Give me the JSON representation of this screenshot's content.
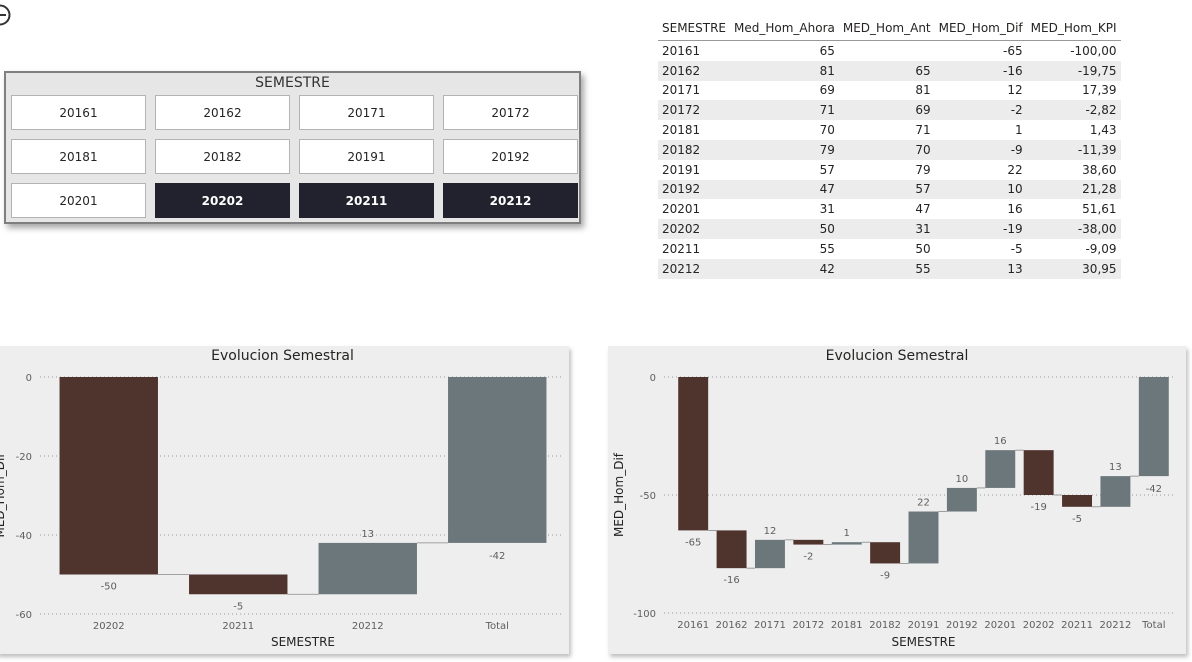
{
  "slicer": {
    "title": "SEMESTRE",
    "items": [
      {
        "label": "20161",
        "selected": false
      },
      {
        "label": "20162",
        "selected": false
      },
      {
        "label": "20171",
        "selected": false
      },
      {
        "label": "20172",
        "selected": false
      },
      {
        "label": "20181",
        "selected": false
      },
      {
        "label": "20182",
        "selected": false
      },
      {
        "label": "20191",
        "selected": false
      },
      {
        "label": "20192",
        "selected": false
      },
      {
        "label": "20201",
        "selected": false
      },
      {
        "label": "20202",
        "selected": true
      },
      {
        "label": "20211",
        "selected": true
      },
      {
        "label": "20212",
        "selected": true
      }
    ]
  },
  "table": {
    "columns": [
      "SEMESTRE",
      "Med_Hom_Ahora",
      "MED_Hom_Ant",
      "MED_Hom_Dif",
      "MED_Hom_KPI"
    ],
    "rows": [
      [
        "20161",
        "65",
        "",
        "-65",
        "-100,00"
      ],
      [
        "20162",
        "81",
        "65",
        "-16",
        "-19,75"
      ],
      [
        "20171",
        "69",
        "81",
        "12",
        "17,39"
      ],
      [
        "20172",
        "71",
        "69",
        "-2",
        "-2,82"
      ],
      [
        "20181",
        "70",
        "71",
        "1",
        "1,43"
      ],
      [
        "20182",
        "79",
        "70",
        "-9",
        "-11,39"
      ],
      [
        "20191",
        "57",
        "79",
        "22",
        "38,60"
      ],
      [
        "20192",
        "47",
        "57",
        "10",
        "21,28"
      ],
      [
        "20201",
        "31",
        "47",
        "16",
        "51,61"
      ],
      [
        "20202",
        "50",
        "31",
        "-19",
        "-38,00"
      ],
      [
        "20211",
        "55",
        "50",
        "-5",
        "-9,09"
      ],
      [
        "20212",
        "42",
        "55",
        "13",
        "30,95"
      ]
    ]
  },
  "colors": {
    "decrease": "#4f332d",
    "increase": "#6b777b",
    "total": "#6b777b",
    "selected": "#22222e"
  },
  "chart_data": [
    {
      "type": "bar",
      "subtype": "waterfall",
      "title": "Evolucion Semestral",
      "xlabel": "SEMESTRE",
      "ylabel": "MED_Hom_Dif",
      "categories": [
        "20202",
        "20211",
        "20212",
        "Total"
      ],
      "values": [
        -50,
        -5,
        13,
        -42
      ],
      "labels": [
        "-50",
        "-5",
        "13",
        "-42"
      ],
      "ylim": [
        -60,
        0
      ],
      "yticks": [
        "0",
        "-20",
        "-40",
        "-60"
      ],
      "grid": true
    },
    {
      "type": "bar",
      "subtype": "waterfall",
      "title": "Evolucion Semestral",
      "xlabel": "SEMESTRE",
      "ylabel": "MED_Hom_Dif",
      "categories": [
        "20161",
        "20162",
        "20171",
        "20172",
        "20181",
        "20182",
        "20191",
        "20192",
        "20201",
        "20202",
        "20211",
        "20212",
        "Total"
      ],
      "values": [
        -65,
        -16,
        12,
        -2,
        1,
        -9,
        22,
        10,
        16,
        -19,
        -5,
        13,
        -42
      ],
      "labels": [
        "-65",
        "-16",
        "12",
        "-2",
        "1",
        "-9",
        "22",
        "10",
        "16",
        "-19",
        "-5",
        "13",
        "-42"
      ],
      "ylim": [
        -100,
        0
      ],
      "yticks": [
        "0",
        "-50",
        "-100"
      ],
      "grid": true
    }
  ]
}
